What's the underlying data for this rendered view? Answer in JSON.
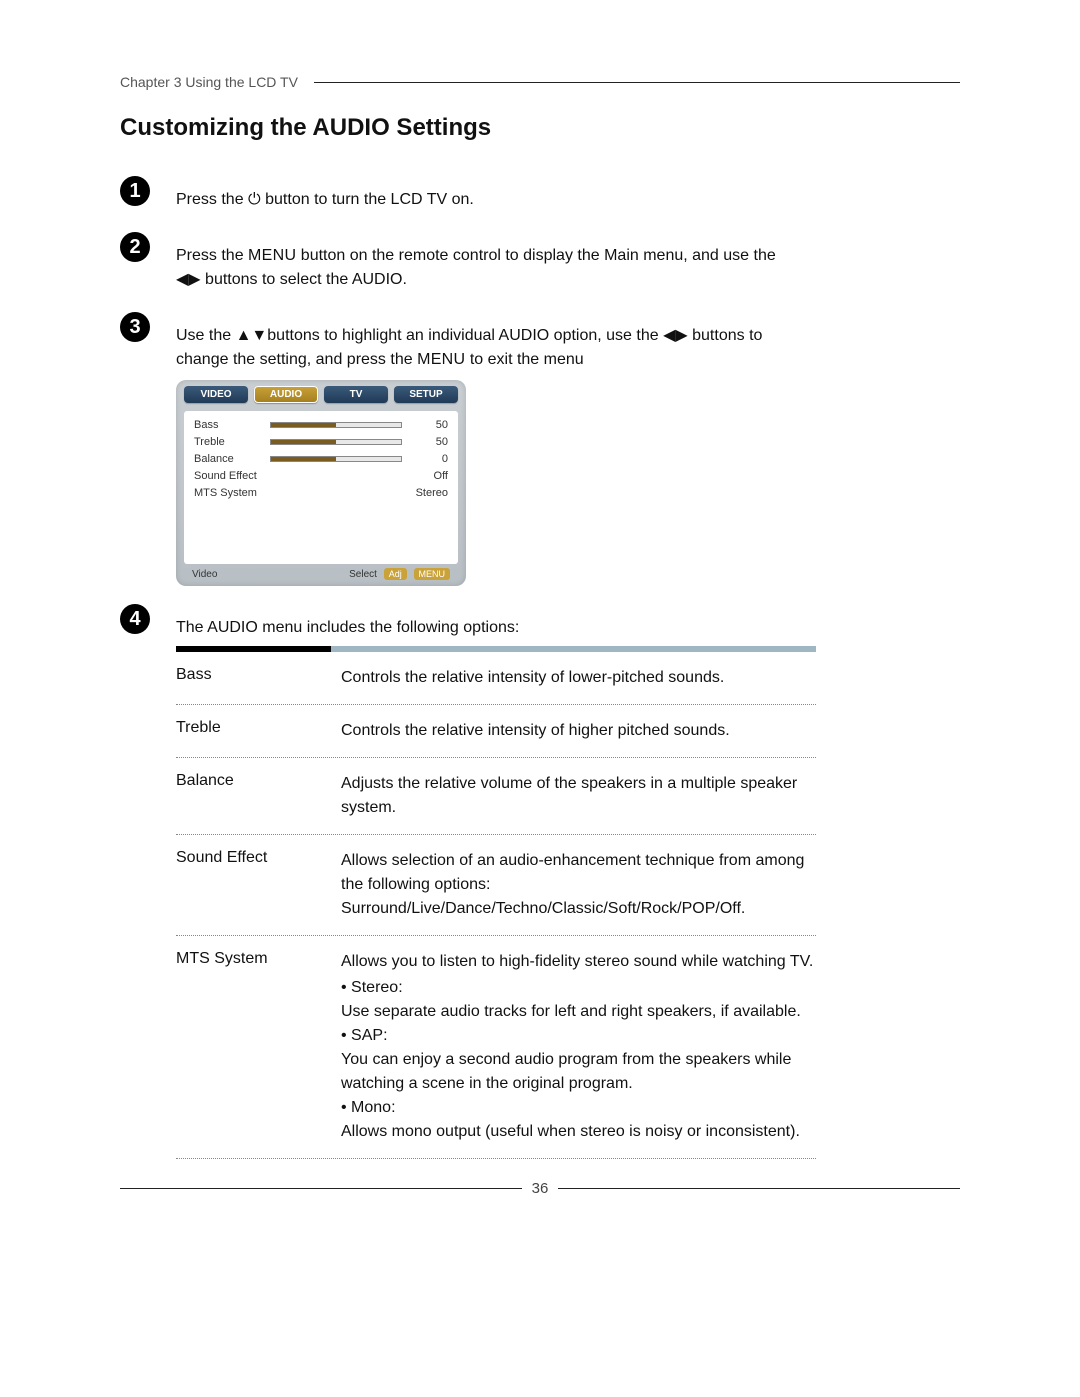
{
  "header": {
    "chapter": "Chapter 3 Using the LCD TV"
  },
  "title": "Customizing the AUDIO Settings",
  "steps": {
    "s1": {
      "num": "1",
      "a": "Press the ",
      "b": " button to turn the LCD TV on."
    },
    "s2": {
      "num": "2",
      "a": "Press the ",
      "menu": "MENU",
      "b": " button on the remote control to display the Main menu, and use the ",
      "arrows": "◀▶",
      "c": " buttons to select the ",
      "audio": "AUDIO",
      "d": "."
    },
    "s3": {
      "num": "3",
      "a": "Use the ",
      "ud": "▲▼",
      "b": "buttons to highlight an individual AUDIO option, use the ",
      "lr": "◀▶",
      "c": " buttons to change the setting, and press the ",
      "menu": "MENU",
      "d": " to exit the menu"
    },
    "s4": {
      "num": "4",
      "a": "The ",
      "audio": "AUDIO",
      "b": " menu includes the following options:"
    }
  },
  "osd": {
    "tabs": {
      "video": "VIDEO",
      "audio": "AUDIO",
      "tv": "TV",
      "setup": "SETUP"
    },
    "rows": [
      {
        "label": "Bass",
        "value": "50",
        "slider": 50
      },
      {
        "label": "Treble",
        "value": "50",
        "slider": 50
      },
      {
        "label": "Balance",
        "value": "0",
        "slider": 50
      },
      {
        "label": "Sound Effect",
        "value": "Off",
        "slider": null
      },
      {
        "label": "MTS System",
        "value": "Stereo",
        "slider": null
      }
    ],
    "footer": {
      "left": "Video",
      "select": "Select",
      "adj": "Adj",
      "menu": "MENU"
    }
  },
  "options": [
    {
      "name": "Bass",
      "desc": "Controls the relative intensity of lower-pitched sounds."
    },
    {
      "name": "Treble",
      "desc": "Controls the relative intensity of higher pitched sounds."
    },
    {
      "name": "Balance",
      "desc": "Adjusts the relative volume of the speakers in a multiple speaker system."
    },
    {
      "name": "Sound Effect",
      "desc": "Allows selection of an audio-enhancement technique from among the following options: Surround/Live/Dance/Techno/Classic/Soft/Rock/POP/Off."
    },
    {
      "name": "MTS System",
      "desc": "Allows you to listen to high-fidelity stereo sound while watching TV.",
      "bullets": [
        "Stereo:",
        "Use separate audio tracks for left and right speakers, if available.",
        "SAP:",
        "You can enjoy a second audio program from the speakers while watching a scene in the original program.",
        "Mono:",
        "Allows mono output (useful when stereo is noisy or inconsistent)."
      ]
    }
  ],
  "page_number": "36"
}
